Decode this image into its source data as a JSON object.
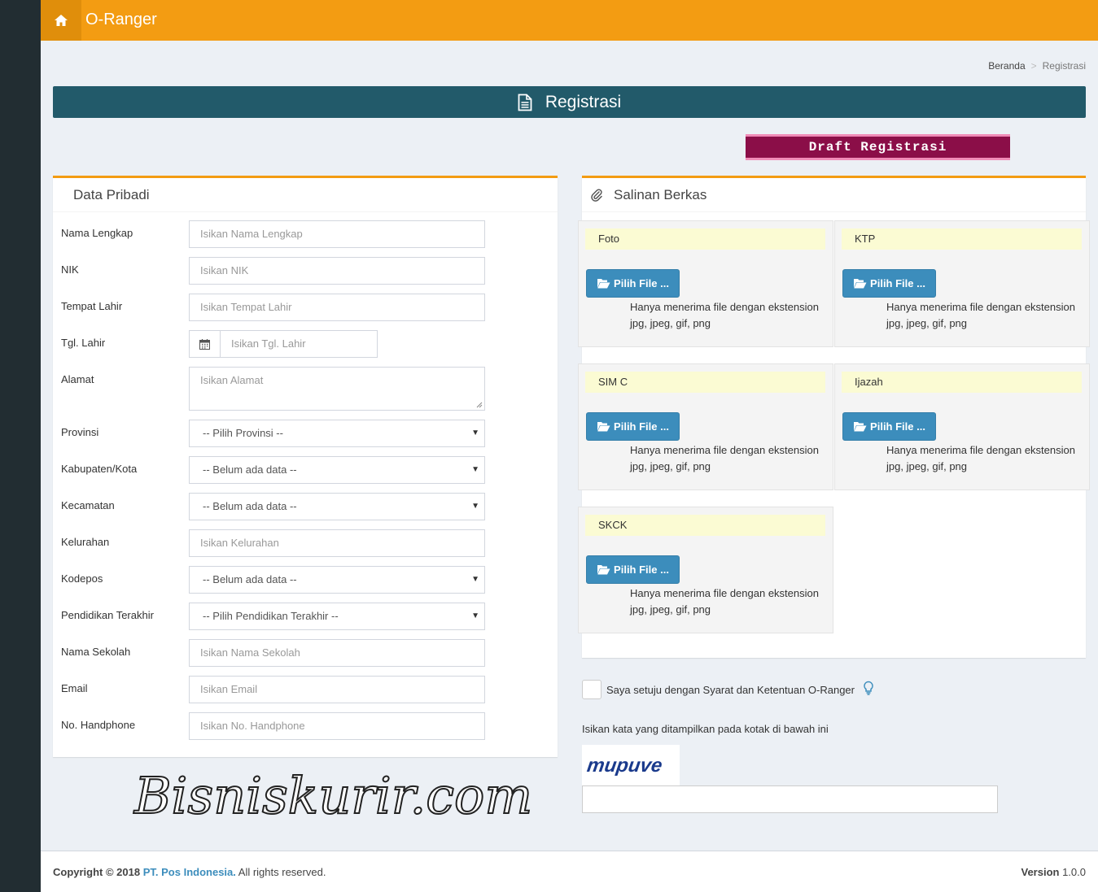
{
  "app": {
    "name": "O-Ranger"
  },
  "breadcrumb": {
    "home": "Beranda",
    "current": "Registrasi"
  },
  "page": {
    "title": "Registrasi",
    "draft_label": "Draft Registrasi"
  },
  "personal": {
    "title": "Data Pribadi",
    "fields": {
      "nama": {
        "label": "Nama Lengkap",
        "placeholder": "Isikan Nama Lengkap"
      },
      "nik": {
        "label": "NIK",
        "placeholder": "Isikan NIK"
      },
      "tempat": {
        "label": "Tempat Lahir",
        "placeholder": "Isikan Tempat Lahir"
      },
      "tgl": {
        "label": "Tgl. Lahir",
        "placeholder": "Isikan Tgl. Lahir"
      },
      "alamat": {
        "label": "Alamat",
        "placeholder": "Isikan Alamat"
      },
      "provinsi": {
        "label": "Provinsi",
        "value": "-- Pilih Provinsi --"
      },
      "kabupaten": {
        "label": "Kabupaten/Kota",
        "value": "-- Belum ada data --"
      },
      "kecamatan": {
        "label": "Kecamatan",
        "value": "-- Belum ada data --"
      },
      "kelurahan": {
        "label": "Kelurahan",
        "placeholder": "Isikan Kelurahan"
      },
      "kodepos": {
        "label": "Kodepos",
        "value": "-- Belum ada data --"
      },
      "pendidikan": {
        "label": "Pendidikan Terakhir",
        "value": "-- Pilih Pendidikan Terakhir --"
      },
      "sekolah": {
        "label": "Nama Sekolah",
        "placeholder": "Isikan Nama Sekolah"
      },
      "email": {
        "label": "Email",
        "placeholder": "Isikan Email"
      },
      "hp": {
        "label": "No. Handphone",
        "placeholder": "Isikan No. Handphone"
      }
    }
  },
  "files": {
    "title": "Salinan Berkas",
    "button_label": "Pilih File ...",
    "note": "Hanya menerima file dengan ekstension jpg, jpeg, gif, png",
    "items": [
      "Foto",
      "KTP",
      "SIM C",
      "Ijazah",
      "SKCK"
    ]
  },
  "agreement": {
    "label": "Saya setuju dengan Syarat dan Ketentuan O-Ranger"
  },
  "captcha": {
    "label": "Isikan kata yang ditampilkan pada kotak di bawah ini",
    "word": "mupuve"
  },
  "watermark": "Bisniskurir.com",
  "footer": {
    "copyright_prefix": "Copyright © 2018",
    "company": "PT. Pos Indonesia.",
    "rights": "All rights reserved.",
    "version_label": "Version",
    "version": "1.0.0"
  },
  "colors": {
    "header": "#f39c12",
    "title_bar": "#225a6a",
    "draft": "#8b0e48",
    "button": "#3c8dbc"
  }
}
